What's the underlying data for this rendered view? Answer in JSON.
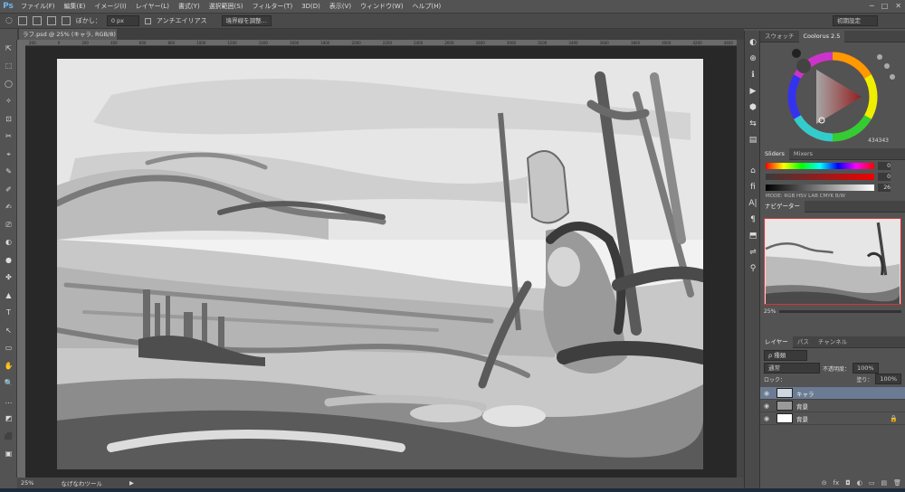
{
  "app": {
    "logo": "Ps"
  },
  "menu": [
    "ファイル(F)",
    "編集(E)",
    "イメージ(I)",
    "レイヤー(L)",
    "書式(Y)",
    "選択範囲(S)",
    "フィルター(T)",
    "3D(D)",
    "表示(V)",
    "ウィンドウ(W)",
    "ヘルプ(H)"
  ],
  "window_controls": [
    "─",
    "□",
    "✕"
  ],
  "options": {
    "feather_label": "ぼかし：",
    "feather_value": "0 px",
    "antialias_label": "アンチエイリアス",
    "refine_edge_label": "境界線を調整...",
    "workspace_label": "初期設定"
  },
  "document_tab": {
    "title": "ラフ.psd @ 25% (キャラ, RGB/8) *",
    "close": "×"
  },
  "ruler_ticks": [
    "200",
    "0",
    "200",
    "400",
    "600",
    "800",
    "1000",
    "1200",
    "1400",
    "1600",
    "1800",
    "2000",
    "2200",
    "2400",
    "2600",
    "2800",
    "3000",
    "3200",
    "3400",
    "3600",
    "3800",
    "4000",
    "4200",
    "4400"
  ],
  "status": {
    "zoom": "25%",
    "tool_name": "なげなわツール",
    "arrow": "▶"
  },
  "tools": [
    "⇱",
    "⬚",
    "◯",
    "✧",
    "⊡",
    "✂",
    "⌖",
    "✎",
    "✐",
    "✍",
    "⎚",
    "◐",
    "●",
    "✤",
    "▲",
    "T",
    "↖",
    "▭",
    "✋",
    "🔍",
    "…",
    "◩",
    "⬛",
    "▣"
  ],
  "strip_icons": [
    "◐",
    "⊕",
    "ℹ",
    "▶",
    "⬢",
    "⇆",
    "▤",
    "⌂",
    "fi",
    "A|",
    "¶",
    "⬒",
    "⇌",
    "⚲"
  ],
  "coolorus": {
    "tabs": [
      "スウォッチ",
      "Coolorus 2.5"
    ],
    "hex": "434343",
    "colors": {
      "hue": "#e03030",
      "foreground": "#434343"
    }
  },
  "sliders": {
    "tabs": [
      "Sliders",
      "Mixers"
    ],
    "rows": [
      {
        "value": "0"
      },
      {
        "value": "0"
      },
      {
        "value": "26"
      }
    ],
    "modes": "MODE: RGB HSV LAB CMYK B/W"
  },
  "navigator": {
    "tab": "ナビゲーター",
    "zoom": "25%"
  },
  "layers": {
    "tabs": [
      "レイヤー",
      "パス",
      "チャンネル"
    ],
    "kind_label": "ρ 種類",
    "blend_mode": "通常",
    "opacity_label": "不透明度：",
    "opacity_value": "100%",
    "lock_label": "ロック：",
    "fill_label": "塗り：",
    "fill_value": "100%",
    "items": [
      {
        "name": "キャラ",
        "selected": true
      },
      {
        "name": "背景",
        "selected": false
      },
      {
        "name": "背景",
        "selected": false,
        "locked": true
      }
    ],
    "footer_icons": [
      "⊝",
      "fx",
      "◘",
      "◐",
      "▭",
      "▤",
      "🗑"
    ]
  }
}
